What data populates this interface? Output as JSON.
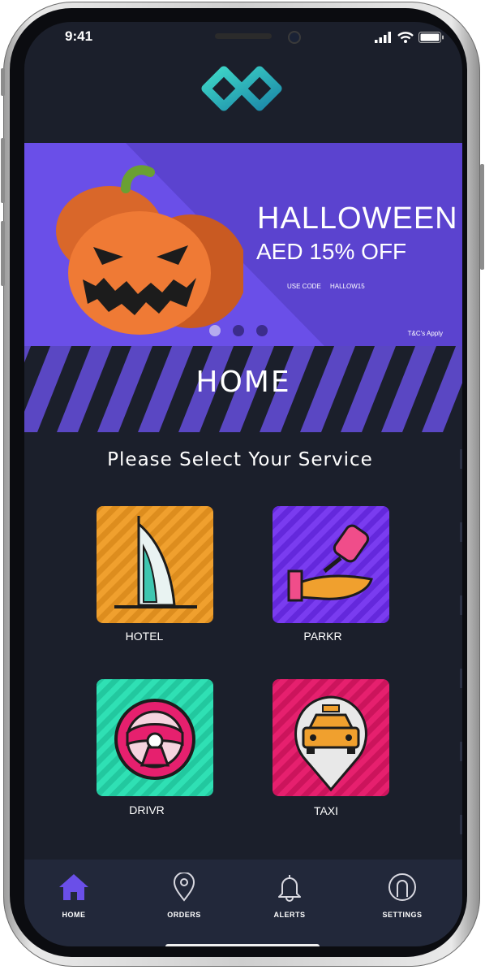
{
  "status": {
    "time": "9:41"
  },
  "banner": {
    "title": "HALLOWEEN",
    "subtitle": "AED 15% OFF",
    "promo_label": "USE CODE",
    "promo_code": "HALLOW15",
    "terms": "T&C's Apply",
    "carousel": {
      "pages": 3,
      "active_index": 0
    }
  },
  "page": {
    "title": "HOME",
    "prompt": "Please Select Your Service"
  },
  "services": [
    {
      "label": "HOTEL",
      "icon": "hotel-icon",
      "color": "#f0a02e"
    },
    {
      "label": "PARKR",
      "icon": "parking-key-icon",
      "color": "#7a3cf0"
    },
    {
      "label": "DRIVR",
      "icon": "steering-wheel-icon",
      "color": "#2fe0b4"
    },
    {
      "label": "TAXI",
      "icon": "taxi-icon",
      "color": "#e6206e"
    }
  ],
  "nav": [
    {
      "label": "HOME",
      "icon": "home-icon",
      "active": true
    },
    {
      "label": "ORDERS",
      "icon": "location-pin-icon",
      "active": false
    },
    {
      "label": "ALERTS",
      "icon": "bell-icon",
      "active": false
    },
    {
      "label": "SETTINGS",
      "icon": "user-icon",
      "active": false
    }
  ],
  "colors": {
    "accent": "#6a4fe8",
    "background": "#1b1f2b",
    "banner": "#5b43cf"
  }
}
